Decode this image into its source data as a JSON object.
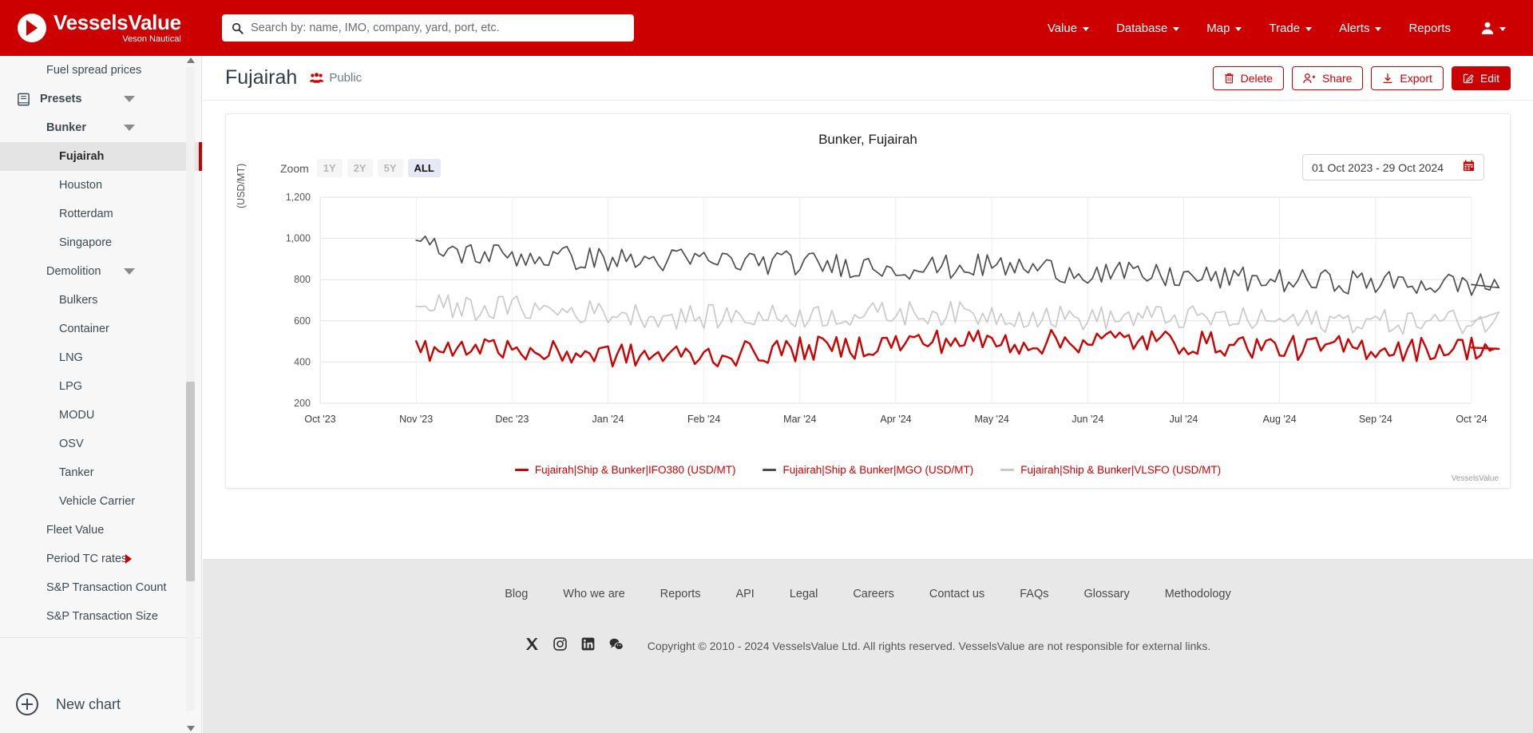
{
  "brand": {
    "name": "VesselsValue",
    "sub": "Veson Nautical",
    "logo_icon": "vesselsvalue-logo-icon"
  },
  "search": {
    "placeholder": "Search by: name, IMO, company, yard, port, etc.",
    "value": "",
    "icon": "search-icon"
  },
  "nav": {
    "items": [
      {
        "label": "Value",
        "has_caret": true
      },
      {
        "label": "Database",
        "has_caret": true
      },
      {
        "label": "Map",
        "has_caret": true
      },
      {
        "label": "Trade",
        "has_caret": true
      },
      {
        "label": "Alerts",
        "has_caret": true
      },
      {
        "label": "Reports",
        "has_caret": false
      }
    ],
    "account_icon": "user-avatar-icon"
  },
  "sidebar": {
    "items": [
      {
        "label": "Fuel spread prices",
        "level": "flat",
        "icon": null,
        "marker": null,
        "active": false
      },
      {
        "label": "Presets",
        "level": "top",
        "icon": "book-icon",
        "marker": "chevron-down",
        "active": false
      },
      {
        "label": "Bunker",
        "level": "group",
        "icon": null,
        "marker": "chevron-down",
        "active": false
      },
      {
        "label": "Fujairah",
        "level": "child",
        "icon": null,
        "marker": null,
        "active": true
      },
      {
        "label": "Houston",
        "level": "child",
        "icon": null,
        "marker": null,
        "active": false
      },
      {
        "label": "Rotterdam",
        "level": "child",
        "icon": null,
        "marker": null,
        "active": false
      },
      {
        "label": "Singapore",
        "level": "child",
        "icon": null,
        "marker": null,
        "active": false
      },
      {
        "label": "Demolition",
        "level": "group",
        "icon": null,
        "marker": "chevron-down",
        "active": false
      },
      {
        "label": "Bulkers",
        "level": "child",
        "icon": null,
        "marker": null,
        "active": false
      },
      {
        "label": "Container",
        "level": "child",
        "icon": null,
        "marker": null,
        "active": false
      },
      {
        "label": "LNG",
        "level": "child",
        "icon": null,
        "marker": null,
        "active": false
      },
      {
        "label": "LPG",
        "level": "child",
        "icon": null,
        "marker": null,
        "active": false
      },
      {
        "label": "MODU",
        "level": "child",
        "icon": null,
        "marker": null,
        "active": false
      },
      {
        "label": "OSV",
        "level": "child",
        "icon": null,
        "marker": null,
        "active": false
      },
      {
        "label": "Tanker",
        "level": "child",
        "icon": null,
        "marker": null,
        "active": false
      },
      {
        "label": "Vehicle Carrier",
        "level": "child",
        "icon": null,
        "marker": null,
        "active": false
      },
      {
        "label": "Fleet Value",
        "level": "flat",
        "icon": null,
        "marker": null,
        "active": false
      },
      {
        "label": "Period TC rates",
        "level": "flat",
        "icon": null,
        "marker": "chevron-right",
        "active": false
      },
      {
        "label": "S&P Transaction Count",
        "level": "flat",
        "icon": null,
        "marker": null,
        "active": false
      },
      {
        "label": "S&P Transaction Size",
        "level": "flat",
        "icon": null,
        "marker": null,
        "active": false
      }
    ],
    "new_chart": {
      "label": "New chart",
      "icon": "plus-circle-icon"
    }
  },
  "page": {
    "title": "Fujairah",
    "visibility": "Public",
    "visibility_icon": "people-group-icon",
    "actions": [
      {
        "label": "Delete",
        "icon": "trash-icon",
        "style": "outline"
      },
      {
        "label": "Share",
        "icon": "user-plus-icon",
        "style": "outline"
      },
      {
        "label": "Export",
        "icon": "download-icon",
        "style": "outline"
      },
      {
        "label": "Edit",
        "icon": "pencil-square-icon",
        "style": "primary"
      }
    ]
  },
  "chart_panel": {
    "zoom_label": "Zoom",
    "zoom_options": [
      {
        "label": "1Y",
        "selected": false
      },
      {
        "label": "2Y",
        "selected": false
      },
      {
        "label": "5Y",
        "selected": false
      },
      {
        "label": "ALL",
        "selected": true
      }
    ],
    "date_range": {
      "value": "01 Oct 2023 - 29 Oct 2024",
      "icon": "calendar-icon"
    },
    "watermark": "VesselsValue"
  },
  "colors": {
    "brand_red": "#CC0000",
    "series_ifo380": "#CC0000",
    "series_mgo": "#4D4D4D",
    "series_vlsfo": "#C9C9C9",
    "sidebar_bg": "#F7F7F7",
    "footer_bg": "#E8E8E8",
    "zoom_selected_bg": "#E6E9F5"
  },
  "chart_data": {
    "type": "line",
    "title": "Bunker, Fujairah",
    "xlabel": "",
    "ylabel": "(USD/MT)",
    "ylim": [
      200,
      1200
    ],
    "yticks": [
      200,
      400,
      600,
      800,
      1000,
      1200
    ],
    "ytick_labels": [
      "200",
      "400",
      "600",
      "800",
      "1,000",
      "1,200"
    ],
    "grid": true,
    "legend_position": "bottom",
    "x": [
      "Oct '23",
      "Nov '23",
      "Dec '23",
      "Jan '24",
      "Feb '24",
      "Mar '24",
      "Apr '24",
      "May '24",
      "Jun '24",
      "Jul '24",
      "Aug '24",
      "Sep '24",
      "Oct '24"
    ],
    "xtick_labels": [
      "Oct '23",
      "Nov '23",
      "Dec '23",
      "Jan '24",
      "Feb '24",
      "Mar '24",
      "Apr '24",
      "May '24",
      "Jun '24",
      "Jul '24",
      "Aug '24",
      "Sep '24",
      "Oct '24"
    ],
    "x_data_start": "Nov '23",
    "series": [
      {
        "name": "Fujairah|Ship & Bunker|IFO380 (USD/MT)",
        "color": "#CC0000",
        "values": [
          null,
          466,
          462,
          452,
          448,
          442,
          443,
          435,
          428,
          432,
          430,
          438,
          452,
          462,
          468,
          478,
          492,
          500,
          505,
          498,
          492,
          498,
          505,
          508,
          502,
          495,
          488,
          480,
          470,
          465,
          472,
          468,
          462,
          466,
          470
        ]
      },
      {
        "name": "Fujairah|Ship & Bunker|MGO (USD/MT)",
        "color": "#4D4D4D",
        "values": [
          null,
          968,
          940,
          922,
          918,
          908,
          905,
          898,
          890,
          896,
          892,
          888,
          885,
          878,
          872,
          868,
          862,
          858,
          862,
          868,
          856,
          848,
          838,
          826,
          818,
          812,
          806,
          800,
          796,
          788,
          792,
          786,
          780,
          778,
          776
        ]
      },
      {
        "name": "Fujairah|Ship & Bunker|VLSFO (USD/MT)",
        "color": "#C9C9C9",
        "values": [
          null,
          672,
          668,
          660,
          665,
          652,
          646,
          640,
          628,
          620,
          618,
          622,
          620,
          624,
          628,
          630,
          636,
          640,
          634,
          630,
          626,
          618,
          612,
          614,
          620,
          616,
          610,
          604,
          600,
          598,
          602,
          596,
          592,
          600,
          596
        ]
      }
    ]
  },
  "footer": {
    "links": [
      "Blog",
      "Who we are",
      "Reports",
      "API",
      "Legal",
      "Careers",
      "Contact us",
      "FAQs",
      "Glossary",
      "Methodology"
    ],
    "socials": [
      "x-twitter-icon",
      "instagram-icon",
      "linkedin-icon",
      "wechat-icon"
    ],
    "copyright": "Copyright © 2010 - 2024 VesselsValue Ltd. All rights reserved. VesselsValue are not responsible for external links."
  }
}
